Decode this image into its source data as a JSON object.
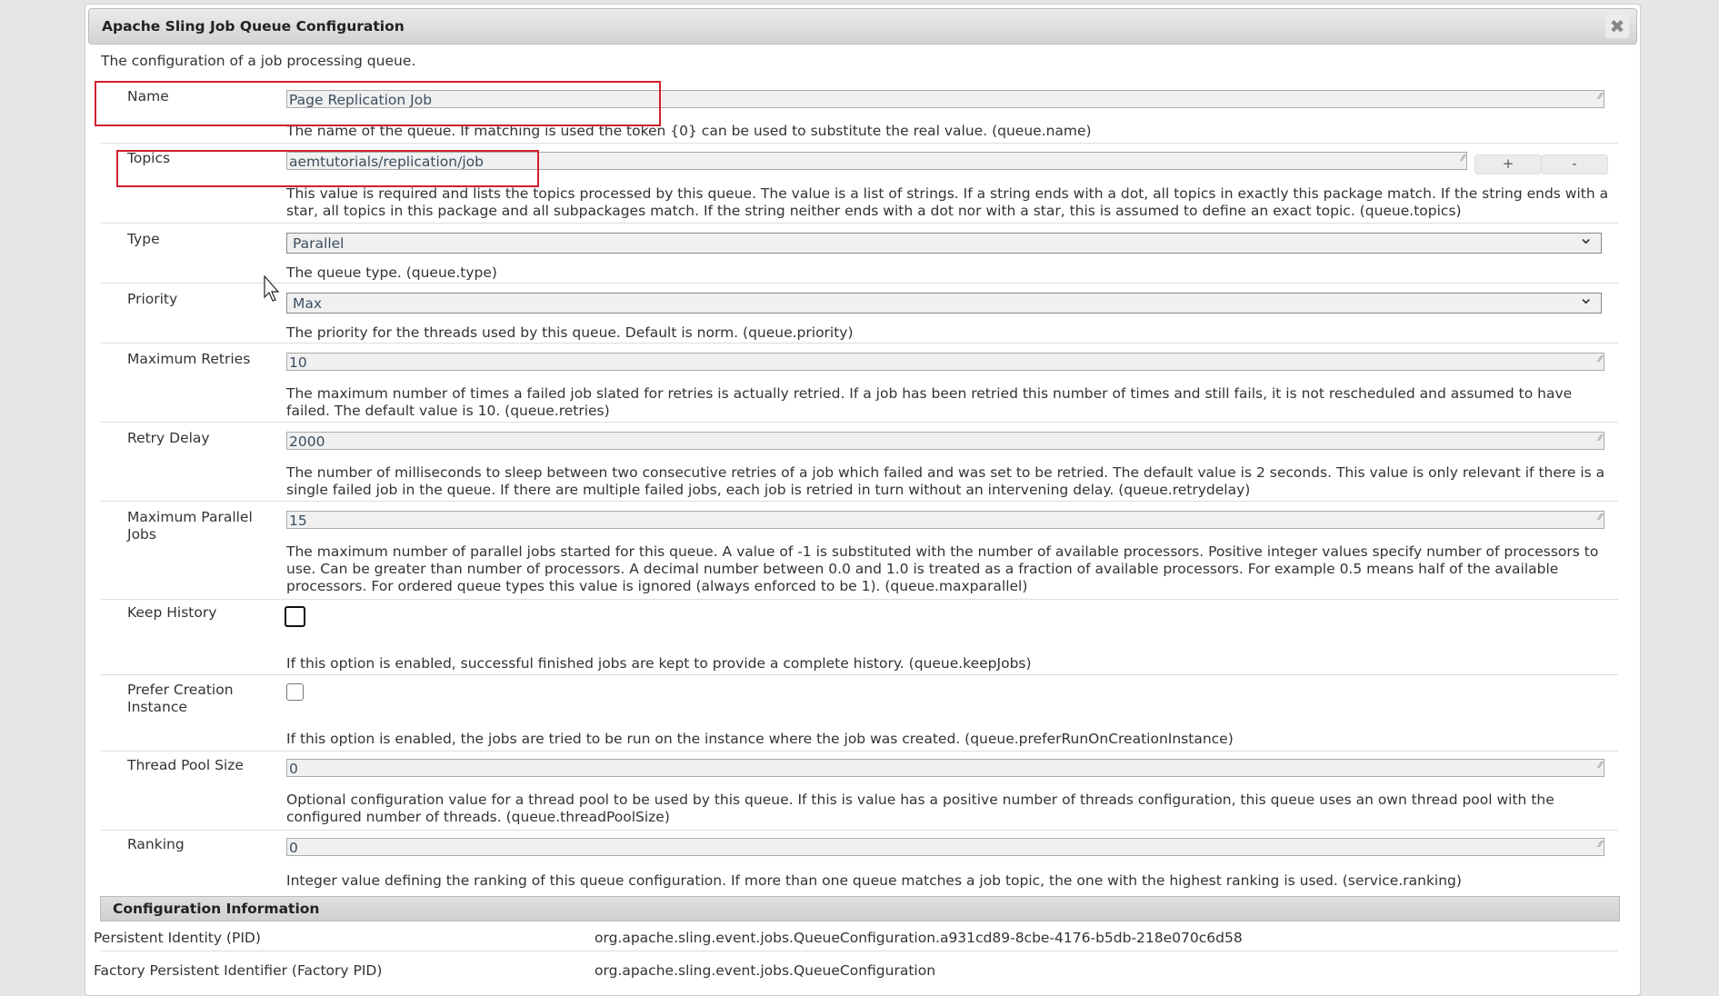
{
  "dialog": {
    "title": "Apache Sling Job Queue Configuration",
    "description": "The configuration of a job processing queue.",
    "close_icon": "close-icon"
  },
  "fields": [
    {
      "label": "Name",
      "type": "text",
      "value": "Page Replication Job",
      "help": "The name of the queue. If matching is used the token {0} can be used to substitute the real value. (queue.name)",
      "highlighted": true
    },
    {
      "label": "Topics",
      "type": "text-multi",
      "value": "aemtutorials/replication/job",
      "help": "This value is required and lists the topics processed by this queue. The value is a list of strings. If a string ends with a dot, all topics in exactly this package match. If the string ends with a star, all topics in this package and all subpackages match. If the string neither ends with a dot nor with a star, this is assumed to define an exact topic. (queue.topics)",
      "highlighted": true,
      "add_label": "+",
      "remove_label": "-"
    },
    {
      "label": "Type",
      "type": "select",
      "value": "Parallel",
      "help": "The queue type. (queue.type)"
    },
    {
      "label": "Priority",
      "type": "select",
      "value": "Max",
      "help": "The priority for the threads used by this queue. Default is norm. (queue.priority)"
    },
    {
      "label": "Maximum Retries",
      "type": "text",
      "value": "10",
      "help": "The maximum number of times a failed job slated for retries is actually retried. If a job has been retried this number of times and still fails, it is not rescheduled and assumed to have failed. The default value is 10. (queue.retries)"
    },
    {
      "label": "Retry Delay",
      "type": "text",
      "value": "2000",
      "help": "The number of milliseconds to sleep between two consecutive retries of a job which failed and was set to be retried. The default value is 2 seconds. This value is only relevant if there is a single failed job in the queue. If there are multiple failed jobs, each job is retried in turn without an intervening delay. (queue.retrydelay)"
    },
    {
      "label": "Maximum Parallel Jobs",
      "type": "text",
      "value": "15",
      "help": "The maximum number of parallel jobs started for this queue. A value of -1 is substituted with the number of available processors. Positive integer values specify number of processors to use. Can be greater than number of processors. A decimal number between 0.0 and 1.0 is treated as a fraction of available processors. For example 0.5 means half of the available processors. For ordered queue types this value is ignored (always enforced to be 1). (queue.maxparallel)"
    },
    {
      "label": "Keep History",
      "type": "checkbox",
      "checked": false,
      "help": "If this option is enabled, successful finished jobs are kept to provide a complete history. (queue.keepJobs)"
    },
    {
      "label": "Prefer Creation Instance",
      "type": "checkbox",
      "checked": false,
      "help": "If this option is enabled, the jobs are tried to be run on the instance where the job was created. (queue.preferRunOnCreationInstance)"
    },
    {
      "label": "Thread Pool Size",
      "type": "text",
      "value": "0",
      "help": "Optional configuration value for a thread pool to be used by this queue. If this is value has a positive number of threads configuration, this queue uses an own thread pool with the configured number of threads. (queue.threadPoolSize)"
    },
    {
      "label": "Ranking",
      "type": "text",
      "value": "0",
      "help": "Integer value defining the ranking of this queue configuration. If more than one queue matches a job topic, the one with the highest ranking is used. (service.ranking)"
    }
  ],
  "config_info": {
    "title": "Configuration Information",
    "rows": [
      {
        "label": "Persistent Identity (PID)",
        "value": "org.apache.sling.event.jobs.QueueConfiguration.a931cd89-8cbe-4176-b5db-218e070c6d58"
      },
      {
        "label": "Factory Persistent Identifier (Factory PID)",
        "value": "org.apache.sling.event.jobs.QueueConfiguration"
      }
    ]
  },
  "colors": {
    "highlight": "#d0202a"
  }
}
